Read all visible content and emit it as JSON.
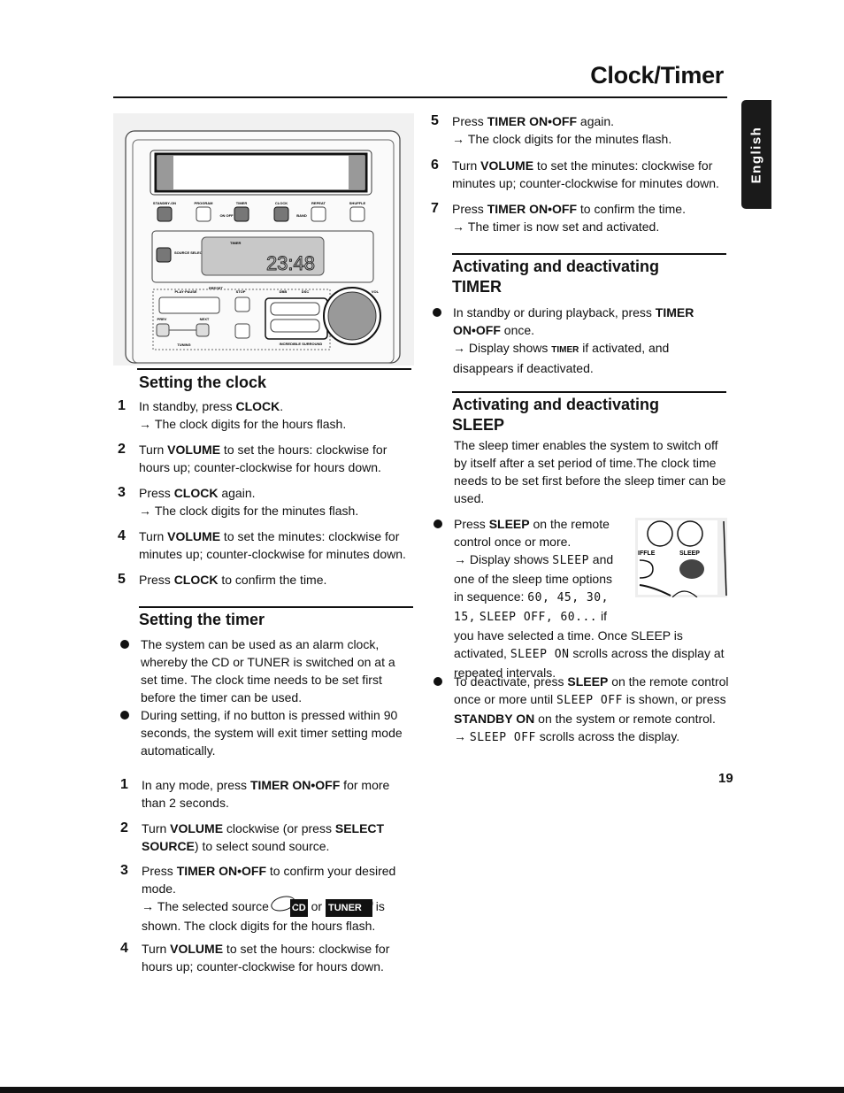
{
  "header": {
    "title": "Clock/Timer",
    "language_tab": "English"
  },
  "page_number": "19",
  "illustration": {
    "display_time": "23:48",
    "labels": {
      "standby": "STANDBY-ON",
      "program": "PROGRAM",
      "timer": "TIMER",
      "clock": "CLOCK",
      "repeat": "REPEAT",
      "shuffle": "SHUFFLE",
      "onoff": "ON OFF",
      "band": "BAND",
      "source_select": "SOURCE SELECT",
      "lcd_timer": "TIMER",
      "preset": "PRESET",
      "play_pause": "PLAY·PAUSE",
      "stop": "STOP",
      "dbb": "DBB",
      "dsc": "DSC",
      "vol": "VOL",
      "prev": "PREV",
      "next": "NEXT",
      "tuning": "TUNING",
      "surround": "INCREDIBLE SURROUND"
    }
  },
  "sleep_illustration": {
    "shuffle": "IFFLE",
    "sleep": "SLEEP"
  },
  "left": {
    "clock_heading": "Setting the clock",
    "clock_steps": [
      {
        "num": "1",
        "runs": [
          [
            "In standby, press ",
            ""
          ],
          [
            "CLOCK",
            "b"
          ],
          [
            ".",
            ""
          ]
        ],
        "arrow": [
          [
            "The clock digits for the hours flash.",
            ""
          ]
        ]
      },
      {
        "num": "2",
        "runs": [
          [
            "Turn ",
            ""
          ],
          [
            "VOLUME",
            "b"
          ],
          [
            " to set the hours: clockwise for hours up; counter-clockwise for hours down.",
            ""
          ]
        ]
      },
      {
        "num": "3",
        "runs": [
          [
            "Press ",
            ""
          ],
          [
            "CLOCK",
            "b"
          ],
          [
            " again.",
            ""
          ]
        ],
        "arrow": [
          [
            "The clock digits for the minutes flash.",
            ""
          ]
        ]
      },
      {
        "num": "4",
        "runs": [
          [
            "Turn ",
            ""
          ],
          [
            "VOLUME",
            "b"
          ],
          [
            " to set the minutes: clockwise for minutes up; counter-clockwise for minutes down.",
            ""
          ]
        ]
      },
      {
        "num": "5",
        "runs": [
          [
            "Press ",
            ""
          ],
          [
            "CLOCK",
            "b"
          ],
          [
            " to confirm the time.",
            ""
          ]
        ]
      }
    ],
    "timer_heading": "Setting the timer",
    "timer_bullets": [
      {
        "runs": [
          [
            "The system can be used as an alarm clock, whereby the CD or TUNER is switched on at a set time. The clock time needs to be set first before the timer can be used.",
            ""
          ]
        ]
      },
      {
        "runs": [
          [
            "During setting, if no button is pressed within 90 seconds, the system will exit timer setting mode automatically.",
            ""
          ]
        ]
      }
    ],
    "timer_steps": [
      {
        "num": "1",
        "runs": [
          [
            "In any mode, press ",
            ""
          ],
          [
            "TIMER ON•OFF",
            "b"
          ],
          [
            " for more than 2 seconds.",
            ""
          ]
        ]
      },
      {
        "num": "2",
        "runs": [
          [
            "Turn ",
            ""
          ],
          [
            "VOLUME",
            "b"
          ],
          [
            " clockwise (or press ",
            ""
          ],
          [
            "SELECT SOURCE",
            "b"
          ],
          [
            ") to select sound source.",
            ""
          ]
        ]
      },
      {
        "num": "3",
        "runs": [
          [
            "Press ",
            ""
          ],
          [
            "TIMER ON•OFF",
            "b"
          ],
          [
            " to confirm your desired mode.",
            ""
          ]
        ],
        "arrow": [
          [
            "The selected source ",
            ""
          ],
          [
            "CD",
            "cd"
          ],
          [
            " or ",
            ""
          ],
          [
            "TUNER",
            "tuner"
          ],
          [
            " is shown. The clock digits for the hours flash.",
            ""
          ]
        ]
      },
      {
        "num": "4",
        "runs": [
          [
            "Turn ",
            ""
          ],
          [
            "VOLUME",
            "b"
          ],
          [
            " to set the hours: clockwise for hours up; counter-clockwise for hours down.",
            ""
          ]
        ]
      }
    ]
  },
  "right": {
    "steps": [
      {
        "num": "5",
        "runs": [
          [
            "Press ",
            ""
          ],
          [
            "TIMER ON•OFF",
            "b"
          ],
          [
            " again.",
            ""
          ]
        ],
        "arrow": [
          [
            "The clock digits for the minutes flash.",
            ""
          ]
        ]
      },
      {
        "num": "6",
        "runs": [
          [
            "Turn ",
            ""
          ],
          [
            "VOLUME",
            "b"
          ],
          [
            " to set the minutes: clockwise for minutes up; counter-clockwise for minutes down.",
            ""
          ]
        ]
      },
      {
        "num": "7",
        "runs": [
          [
            "Press ",
            ""
          ],
          [
            "TIMER ON•OFF",
            "b"
          ],
          [
            " to confirm the time.",
            ""
          ]
        ],
        "arrow": [
          [
            "The timer is now set and activated.",
            ""
          ]
        ]
      }
    ],
    "timer_act_heading": [
      "Activating and deactivating",
      "TIMER"
    ],
    "timer_act_bullets": [
      {
        "runs": [
          [
            "In standby or during playback, press ",
            ""
          ],
          [
            "TIMER ON•OFF",
            "b"
          ],
          [
            " once.",
            ""
          ]
        ],
        "arrow": [
          [
            "Display shows ",
            ""
          ],
          [
            "TIMER",
            "s"
          ],
          [
            " if activated, and disappears if deactivated.",
            ""
          ]
        ]
      }
    ],
    "sleep_heading": [
      "Activating and deactivating",
      "SLEEP"
    ],
    "sleep_intro": "The sleep timer enables the system to switch off by itself after a set period of time.The clock time needs to be set first before the sleep timer can be used.",
    "sleep_bullets": [
      {
        "runs": [
          [
            "Press ",
            ""
          ],
          [
            "SLEEP",
            "b"
          ],
          [
            " on the remote control once or more.",
            ""
          ]
        ],
        "arrow": [
          [
            "Display shows ",
            ""
          ],
          [
            "SLEEP",
            "l"
          ],
          [
            " and one of the sleep time options in sequence: ",
            ""
          ],
          [
            "60, 45, 30, 15,",
            "l"
          ],
          [
            " ",
            ""
          ],
          [
            "SLEEP OFF, 60...",
            "l"
          ],
          [
            " if you have selected a time. Once SLEEP is activated, ",
            ""
          ],
          [
            "SLEEP ON",
            "l"
          ],
          [
            " scrolls across the display at repeated intervals.",
            ""
          ]
        ]
      },
      {
        "runs": [
          [
            "To deactivate, press ",
            ""
          ],
          [
            "SLEEP",
            "b"
          ],
          [
            " on the remote control once or more until ",
            ""
          ],
          [
            "SLEEP OFF",
            "l"
          ],
          [
            " is shown, or press ",
            ""
          ],
          [
            "STANDBY ON",
            "b"
          ],
          [
            " on the system or remote control.",
            ""
          ]
        ],
        "arrow": [
          [
            "SLEEP OFF",
            "l"
          ],
          [
            " scrolls across the display.",
            ""
          ]
        ]
      }
    ]
  }
}
